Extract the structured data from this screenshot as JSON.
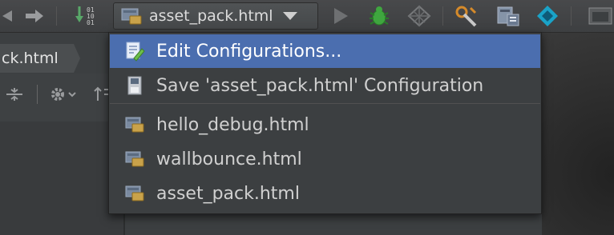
{
  "toolbar": {
    "run_config_label": "asset_pack.html",
    "icons": [
      "arrow-right-icon",
      "binary-icon",
      "run-config-icon",
      "dropdown-caret-icon",
      "run-icon",
      "debug-bug-icon",
      "coverage-icon",
      "wrench-icon",
      "structure-icon",
      "dart-icon",
      "window-icon"
    ]
  },
  "editor": {
    "tab_label": "ck.html"
  },
  "menu": {
    "items": [
      {
        "label": "Edit Configurations...",
        "icon": "edit-config-icon",
        "selected": true
      },
      {
        "label": "Save 'asset_pack.html' Configuration",
        "icon": "save-config-icon",
        "selected": false
      },
      {
        "label": "hello_debug.html",
        "icon": "html-config-icon",
        "selected": false
      },
      {
        "label": "wallbounce.html",
        "icon": "html-config-icon",
        "selected": false
      },
      {
        "label": "asset_pack.html",
        "icon": "html-config-icon",
        "selected": false
      }
    ]
  },
  "colors": {
    "selection": "#4b6eaf",
    "menu_bg": "#3c3f41",
    "text": "#d0d0d0"
  }
}
